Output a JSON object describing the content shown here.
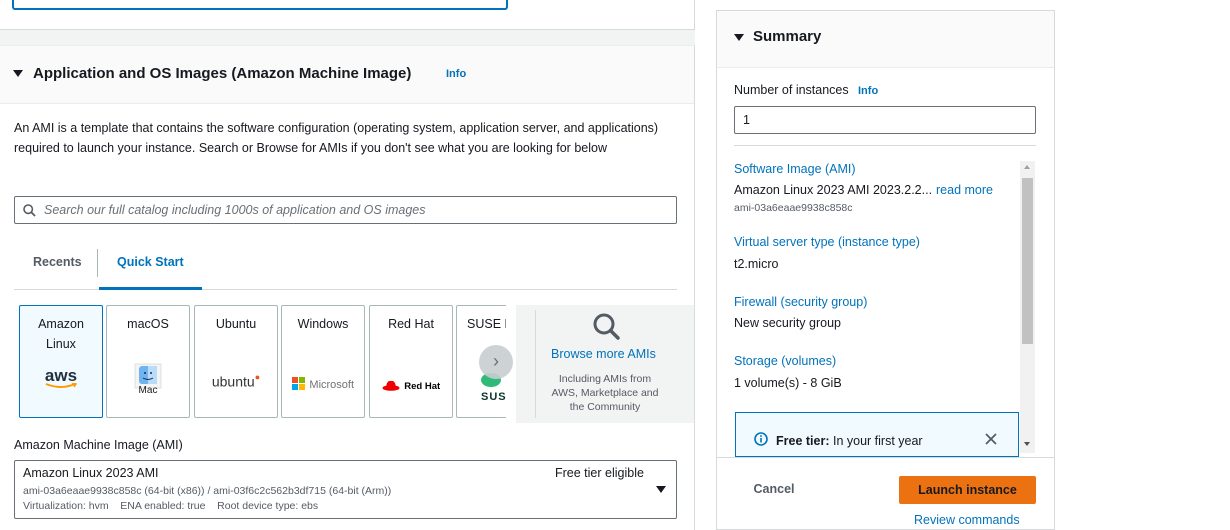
{
  "ami_section": {
    "title": "Application and OS Images (Amazon Machine Image)",
    "info": "Info",
    "description": "An AMI is a template that contains the software configuration (operating system, application server, and applications) required to launch your instance. Search or Browse for AMIs if you don't see what you are looking for below",
    "search_placeholder": "Search our full catalog including 1000s of application and OS images",
    "tabs": [
      "Recents",
      "Quick Start"
    ],
    "tiles": [
      {
        "label": "Amazon Linux",
        "logo": "aws"
      },
      {
        "label": "macOS",
        "logo": "Mac"
      },
      {
        "label": "Ubuntu",
        "logo": "ubuntu"
      },
      {
        "label": "Windows",
        "logo": "Microsoft"
      },
      {
        "label": "Red Hat",
        "logo": "Red Hat"
      },
      {
        "label": "SUSE L",
        "logo": "SUS"
      }
    ],
    "browse_more": {
      "label": "Browse more AMIs",
      "sub": "Including AMIs from AWS, Marketplace and the Community"
    },
    "ami_label": "Amazon Machine Image (AMI)",
    "selected_ami": {
      "name": "Amazon Linux 2023 AMI",
      "badge": "Free tier eligible",
      "ids": "ami-03a6eaae9938c858c (64-bit (x86)) / ami-03f6c2c562b3df715 (64-bit (Arm))",
      "meta": "Virtualization: hvm    ENA enabled: true    Root device type: ebs"
    }
  },
  "summary": {
    "title": "Summary",
    "instances_label": "Number of instances",
    "info": "Info",
    "instances_value": "1",
    "items": [
      {
        "label": "Software Image (AMI)",
        "value": "Amazon Linux 2023 AMI 2023.2.2...",
        "more": "read more",
        "sub": "ami-03a6eaae9938c858c"
      },
      {
        "label": "Virtual server type (instance type)",
        "value": "t2.micro"
      },
      {
        "label": "Firewall (security group)",
        "value": "New security group"
      },
      {
        "label": "Storage (volumes)",
        "value": "1 volume(s) - 8 GiB"
      }
    ],
    "free_tier": {
      "bold": "Free tier:",
      "text": " In your first year"
    },
    "cancel": "Cancel",
    "launch": "Launch instance",
    "review": "Review commands"
  },
  "colors": {
    "accent": "#0073bb",
    "launch": "#ec7211"
  }
}
